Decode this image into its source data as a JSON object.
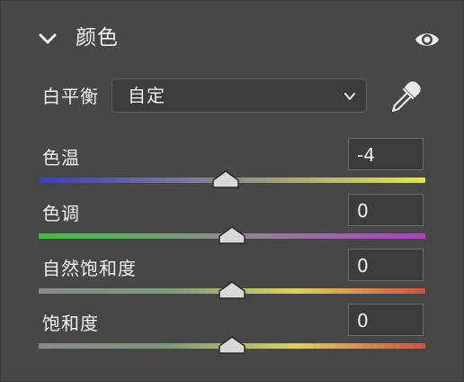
{
  "panel": {
    "title": "颜色"
  },
  "white_balance": {
    "label": "白平衡",
    "selected": "自定"
  },
  "sliders": [
    {
      "label": "色温",
      "value": "-4",
      "level": 0.483,
      "gradient": [
        "#3c3cc0",
        "#8c8c8c",
        "#e6e64a"
      ]
    },
    {
      "label": "色调",
      "value": "0",
      "level": 0.5,
      "gradient": [
        "#3cbf3c",
        "#8c8c8c",
        "#b03cc8"
      ]
    },
    {
      "label": "自然饱和度",
      "value": "0",
      "level": 0.5,
      "gradient": [
        "#8a8a8a",
        "#7a9a7a",
        "#dcd05a",
        "#d05040"
      ]
    },
    {
      "label": "饱和度",
      "value": "0",
      "level": 0.5,
      "gradient": [
        "#8a8a8a",
        "#7a9a7a",
        "#dcd05a",
        "#d05040"
      ]
    }
  ],
  "colors": {
    "background": "#474747",
    "field": "#3c3c3c",
    "thumb": "#d8d8d8"
  }
}
